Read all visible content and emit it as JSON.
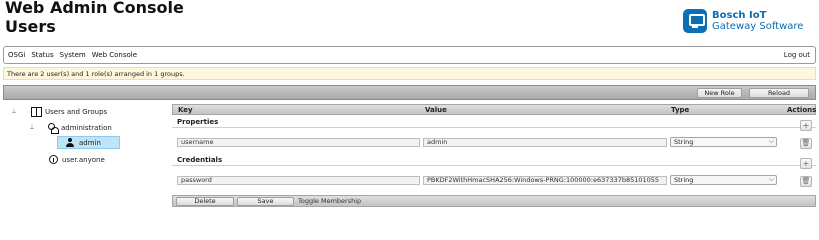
{
  "header": {
    "title_line1": "Web Admin Console",
    "title_line2": "Users",
    "brand_line1": "Bosch IoT",
    "brand_line2": "Gateway Software",
    "brand_color": "#0a6fb5"
  },
  "nav": {
    "items": [
      "OSGi",
      "Status",
      "System",
      "Web Console"
    ],
    "logout": "Log out"
  },
  "status": {
    "text": "There are 2 user(s) and 1 role(s) arranged in 1 groups."
  },
  "toolbar": {
    "new_role": "New Role",
    "reload": "Reload"
  },
  "tree": {
    "root": "Users and Groups",
    "group": "administration",
    "selected_user": "admin",
    "other": "user.anyone"
  },
  "table": {
    "columns": [
      "Key",
      "Value",
      "Type",
      "Actions"
    ],
    "sections": [
      {
        "label": "Properties",
        "rows": [
          {
            "key": "username",
            "value": "admin",
            "type": "String"
          }
        ]
      },
      {
        "label": "Credentials",
        "rows": [
          {
            "key": "password",
            "value": "PBKDF2WithHmacSHA256:Windows-PRNG:100000:e637337b85101055",
            "type": "String"
          }
        ]
      }
    ]
  },
  "bottom": {
    "delete": "Delete",
    "save": "Save",
    "toggle": "Toggle Membership"
  },
  "icons": {
    "add": "+",
    "trash": "🗑",
    "dropdown": "⌵"
  }
}
